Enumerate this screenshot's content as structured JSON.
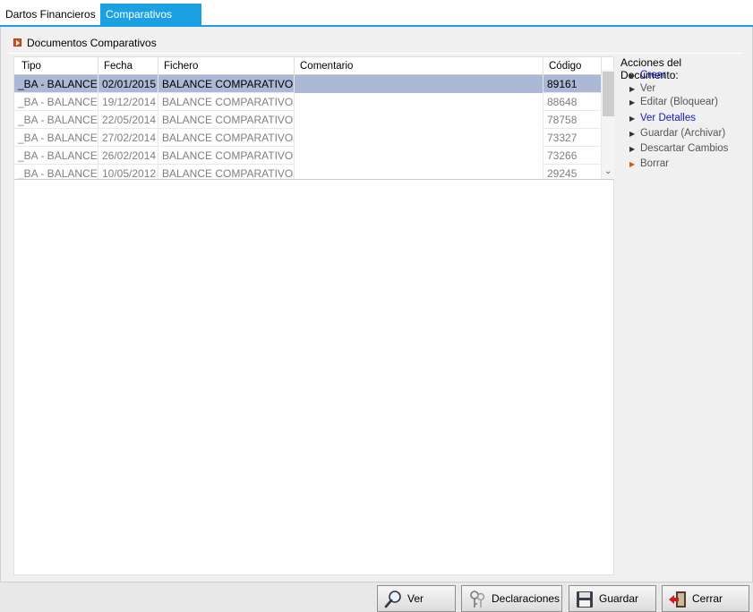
{
  "tabs": [
    {
      "label": "Dartos Financieros",
      "active": false
    },
    {
      "label": "Comparativos",
      "active": true
    }
  ],
  "group": {
    "title": "Documentos Comparativos"
  },
  "grid": {
    "columns": [
      "Tipo",
      "Fecha",
      "Fichero",
      "Comentario",
      "Código"
    ],
    "rows": [
      {
        "tipo": "_BA - BALANCES",
        "fecha": "02/01/2015",
        "fichero": "BALANCE COMPARATIVO.xls",
        "comentario": "",
        "codigo": "89161",
        "selected": true
      },
      {
        "tipo": "_BA - BALANCES",
        "fecha": "19/12/2014",
        "fichero": "BALANCE COMPARATIVO.xls",
        "comentario": "",
        "codigo": "88648",
        "selected": false
      },
      {
        "tipo": "_BA - BALANCES",
        "fecha": "22/05/2014",
        "fichero": "BALANCE COMPARATIVO.xls",
        "comentario": "",
        "codigo": "78758",
        "selected": false
      },
      {
        "tipo": "_BA - BALANCES",
        "fecha": "27/02/2014",
        "fichero": "BALANCE COMPARATIVO.xls",
        "comentario": "",
        "codigo": "73327",
        "selected": false
      },
      {
        "tipo": "_BA - BALANCES",
        "fecha": "26/02/2014",
        "fichero": "BALANCE COMPARATIVO.xls",
        "comentario": "",
        "codigo": "73266",
        "selected": false
      },
      {
        "tipo": "_BA - BALANCES",
        "fecha": "10/05/2012",
        "fichero": "BALANCE COMPARATIVO.xls",
        "comentario": "",
        "codigo": "29245",
        "selected": false
      }
    ]
  },
  "sidebar": {
    "heading": "Acciones del Documento:",
    "actions": [
      {
        "label": "Crear",
        "style": "link"
      },
      {
        "label": "Ver",
        "style": "normal"
      },
      {
        "label": "Editar (Bloquear)",
        "style": "normal"
      },
      {
        "label": "Ver Detalles",
        "style": "link"
      },
      {
        "label": "Guardar (Archivar)",
        "style": "normal"
      },
      {
        "label": "Descartar Cambios",
        "style": "normal"
      },
      {
        "label": "Borrar",
        "style": "danger"
      }
    ]
  },
  "footer": {
    "buttons": [
      {
        "label": "Ver Trans.",
        "icon": "magnifier-icon"
      },
      {
        "label": "Declaraciones",
        "icon": "keys-icon"
      },
      {
        "label": "Guardar",
        "icon": "floppy-disk-icon"
      },
      {
        "label": "Cerrar",
        "icon": "exit-door-icon"
      }
    ]
  },
  "colors": {
    "accent": "#1ba1e2",
    "selection": "#abb8d6",
    "link": "#1a1ab8",
    "bullet": "#d9541a"
  }
}
